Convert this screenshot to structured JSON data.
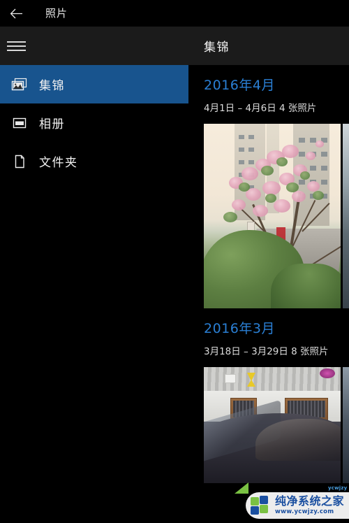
{
  "titlebar": {
    "back_icon": "back-arrow-icon",
    "title": "照片"
  },
  "sidebar": {
    "menu_icon": "hamburger-menu-icon",
    "items": [
      {
        "label": "集锦",
        "icon": "collection-photos-icon",
        "selected": true
      },
      {
        "label": "相册",
        "icon": "album-icon",
        "selected": false
      },
      {
        "label": "文件夹",
        "icon": "folder-page-icon",
        "selected": false
      }
    ]
  },
  "content": {
    "header_title": "集锦",
    "groups": [
      {
        "title": "2016年4月",
        "subtitle": "4月1日 – 4月6日   4 张照片",
        "thumbs": [
          {
            "name": "photo-street-blossoms"
          },
          {
            "name": "photo-partial-right"
          }
        ]
      },
      {
        "title": "2016年3月",
        "subtitle": "3月18日 – 3月29日   8 张照片",
        "thumbs": [
          {
            "name": "photo-car-workshop"
          },
          {
            "name": "photo-partial-right"
          }
        ]
      }
    ]
  },
  "watermark": {
    "name": "纯净系统之家",
    "url": "www.ycwjzy.com",
    "tiny": "ycwjzy"
  },
  "colors": {
    "accent_blue": "#2a7fd4",
    "selection_blue": "#18548e",
    "bar_gray": "#1b1b1b",
    "background": "#000000",
    "text": "#f2f2f2",
    "logo_blue": "#1a4fa0",
    "logo_green": "#7ac143"
  }
}
